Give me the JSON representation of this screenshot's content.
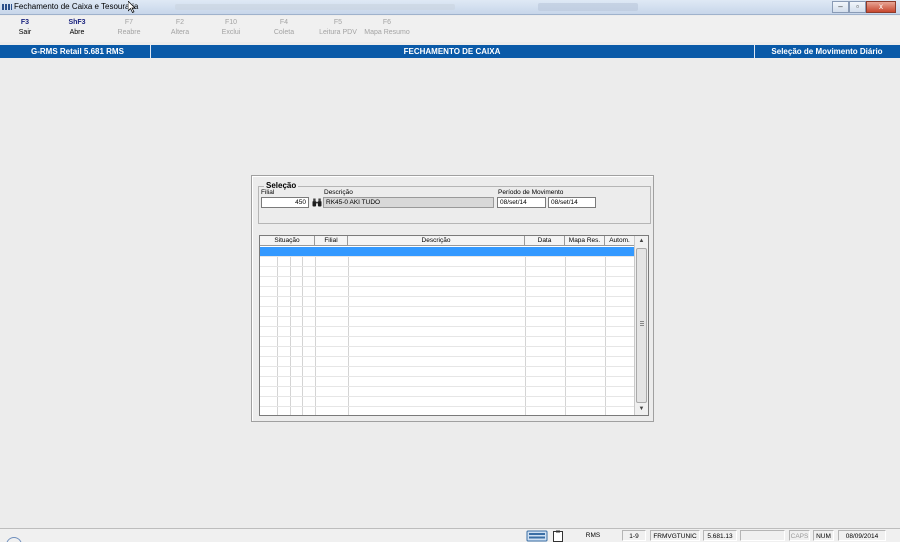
{
  "window": {
    "title": "Fechamento de Caixa e Tesouraria",
    "controls": [
      "–",
      "▫",
      "x"
    ]
  },
  "fkeys": [
    {
      "key": "F3",
      "label": "Sair",
      "enabled": true
    },
    {
      "key": "ShF3",
      "label": "Abre",
      "enabled": true
    },
    {
      "key": "F7",
      "label": "Reabre",
      "enabled": false
    },
    {
      "key": "F2",
      "label": "Altera",
      "enabled": false
    },
    {
      "key": "F10",
      "label": "Exclui",
      "enabled": false
    },
    {
      "key": "F4",
      "label": "Coleta",
      "enabled": false
    },
    {
      "key": "F5",
      "label": "Leitura PDV",
      "enabled": false
    },
    {
      "key": "F6",
      "label": "Mapa Resumo",
      "enabled": false
    }
  ],
  "header": {
    "app_version": "G-RMS Retail 5.681 RMS",
    "screen_title": "FECHAMENTO DE CAIXA",
    "context": "Seleção de Movimento Diário"
  },
  "selection": {
    "title": "Seleção",
    "filial_label": "Filial",
    "filial_value": "450",
    "descricao_label": "Descrição",
    "descricao_value": "RK45-0 AKI TUDO",
    "periodo_label": "Período de Movimento",
    "periodo_start": "08/set/14",
    "periodo_end": "08/set/14"
  },
  "grid": {
    "columns": [
      "Situação",
      "Filial",
      "Descrição",
      "Data",
      "Mapa Res.",
      "Autom."
    ],
    "selected_row": 0,
    "row_count": 16
  },
  "statusbar": {
    "system": "RMS",
    "range": "1-9",
    "program": "FRMVGTUNIC",
    "version": "5.681.13",
    "empty": "",
    "caps": "CAPS",
    "num": "NUM",
    "date": "08/09/2014"
  },
  "colors": {
    "header_bg": "#0a5aa8",
    "selected_row": "#3399ff",
    "fkey_text": "#1a237e"
  }
}
